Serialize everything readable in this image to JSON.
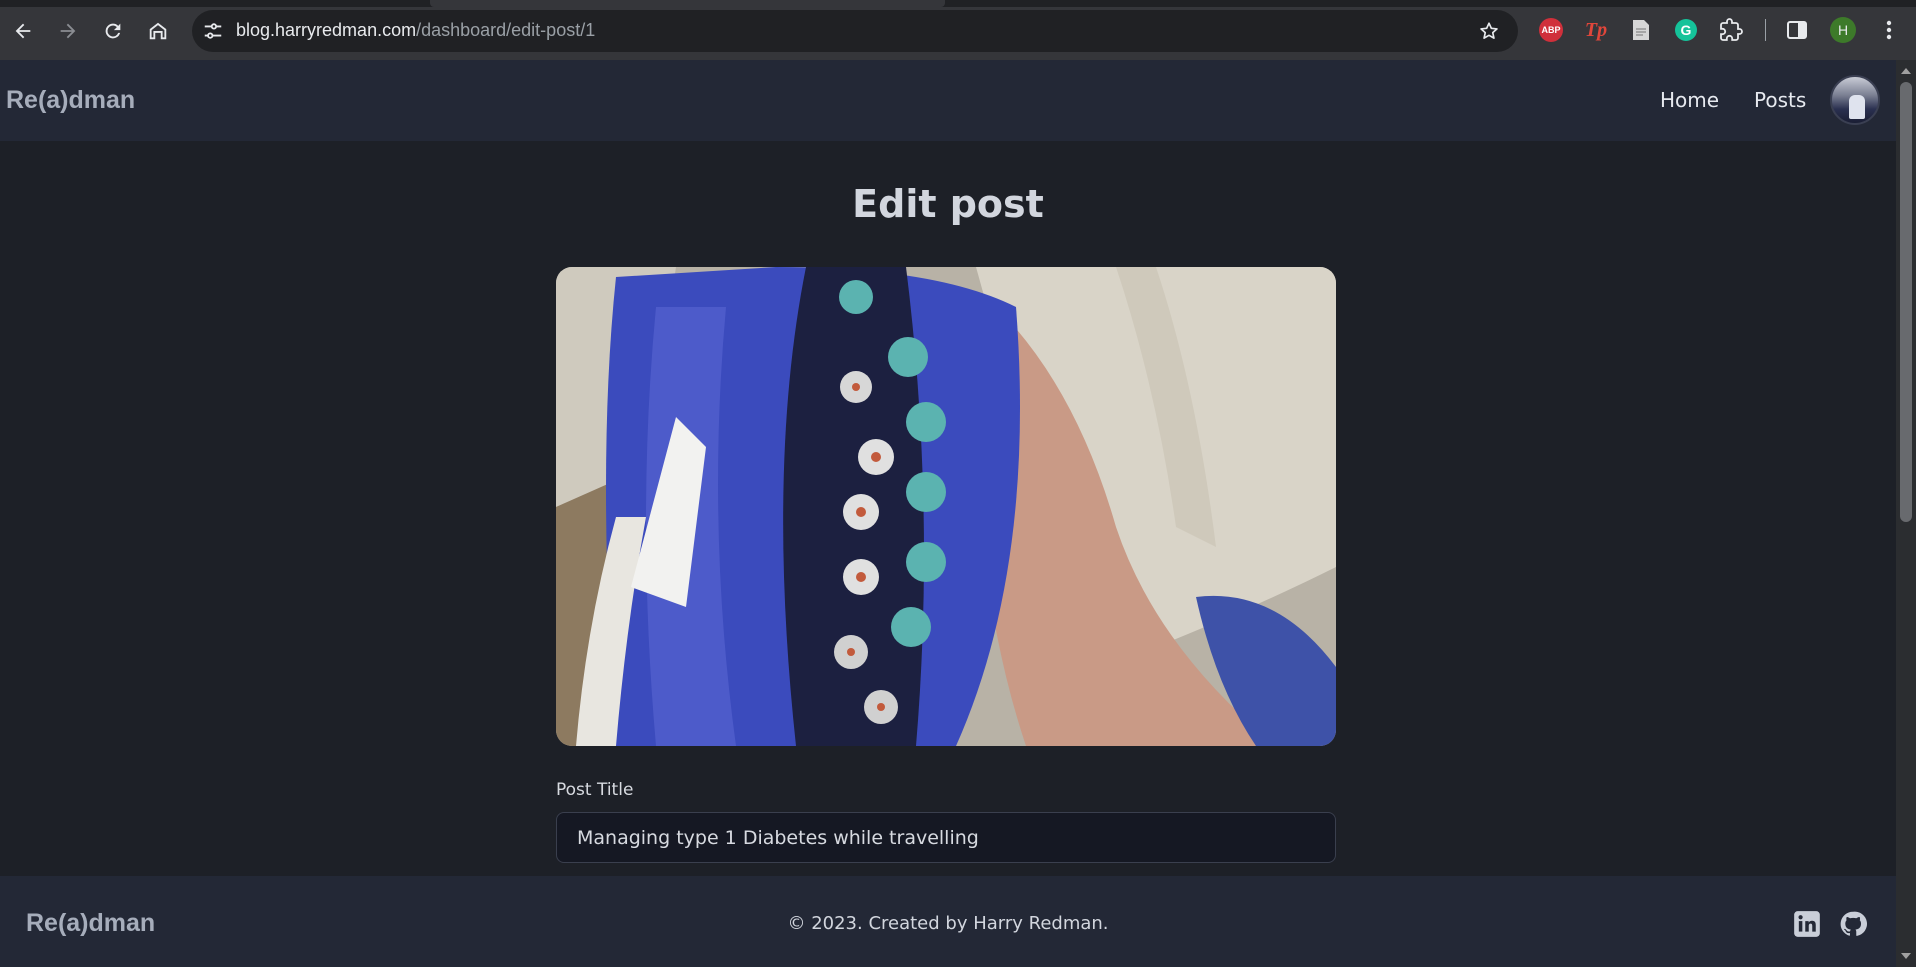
{
  "browser": {
    "url_domain": "blog.harryredman.com",
    "url_path": "/dashboard/edit-post/1",
    "extensions": [
      "adblock-plus-icon",
      "tp-extension-icon",
      "document-extension-icon",
      "grammarly-icon",
      "puzzle-extensions-icon"
    ],
    "abp_label": "ABP",
    "tp_label": "Tp",
    "grammarly_label": "G",
    "profile_initial": "H"
  },
  "header": {
    "brand": "Re(a)dman",
    "nav": [
      {
        "label": "Home"
      },
      {
        "label": "Posts"
      }
    ]
  },
  "main": {
    "title": "Edit post",
    "post_title_label": "Post Title",
    "post_title_value": "Managing type 1 Diabetes while travelling"
  },
  "footer": {
    "brand": "Re(a)dman",
    "copyright": "© 2023. Created by Harry Redman.",
    "social": [
      "linkedin-icon",
      "github-icon"
    ]
  },
  "colors": {
    "page_bg": "#1d2027",
    "header_bg": "#232836",
    "brand": "#a6adbb"
  }
}
